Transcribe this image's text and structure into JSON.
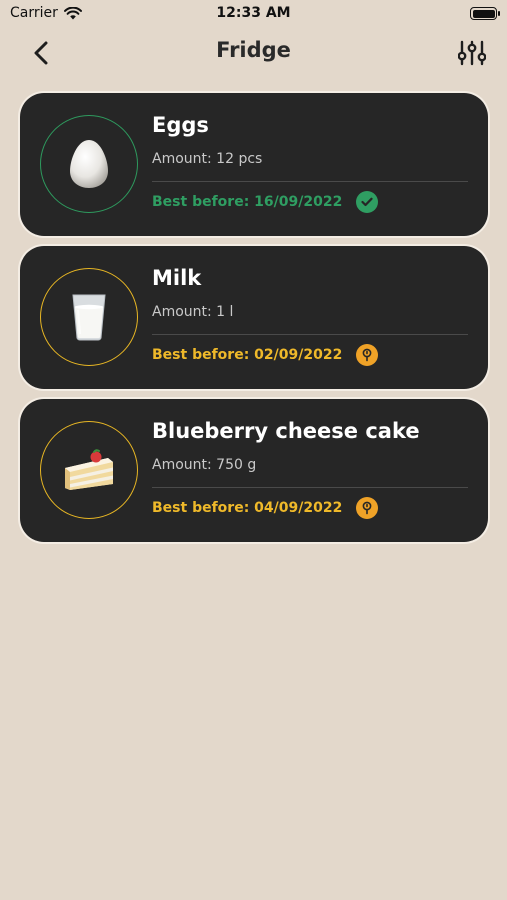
{
  "status_bar": {
    "carrier": "Carrier",
    "time": "12:33 AM"
  },
  "nav": {
    "title": "Fridge",
    "back_icon": "chevron-left-icon",
    "filter_icon": "sliders-icon"
  },
  "colors": {
    "background": "#e3d8cb",
    "card": "#262626",
    "fresh": "#2f9e62",
    "expiring": "#efb92a"
  },
  "items": [
    {
      "name": "Eggs",
      "amount": "Amount: 12  pcs",
      "best_before": "Best before: 16/09/2022",
      "status": "fresh",
      "icon": "egg-icon"
    },
    {
      "name": "Milk",
      "amount": "Amount: 1  l",
      "best_before": "Best before: 02/09/2022",
      "status": "expiring",
      "icon": "milk-glass-icon"
    },
    {
      "name": "Blueberry cheese cake",
      "amount": "Amount: 750  g",
      "best_before": "Best before: 04/09/2022",
      "status": "expiring",
      "icon": "cake-slice-icon"
    }
  ]
}
